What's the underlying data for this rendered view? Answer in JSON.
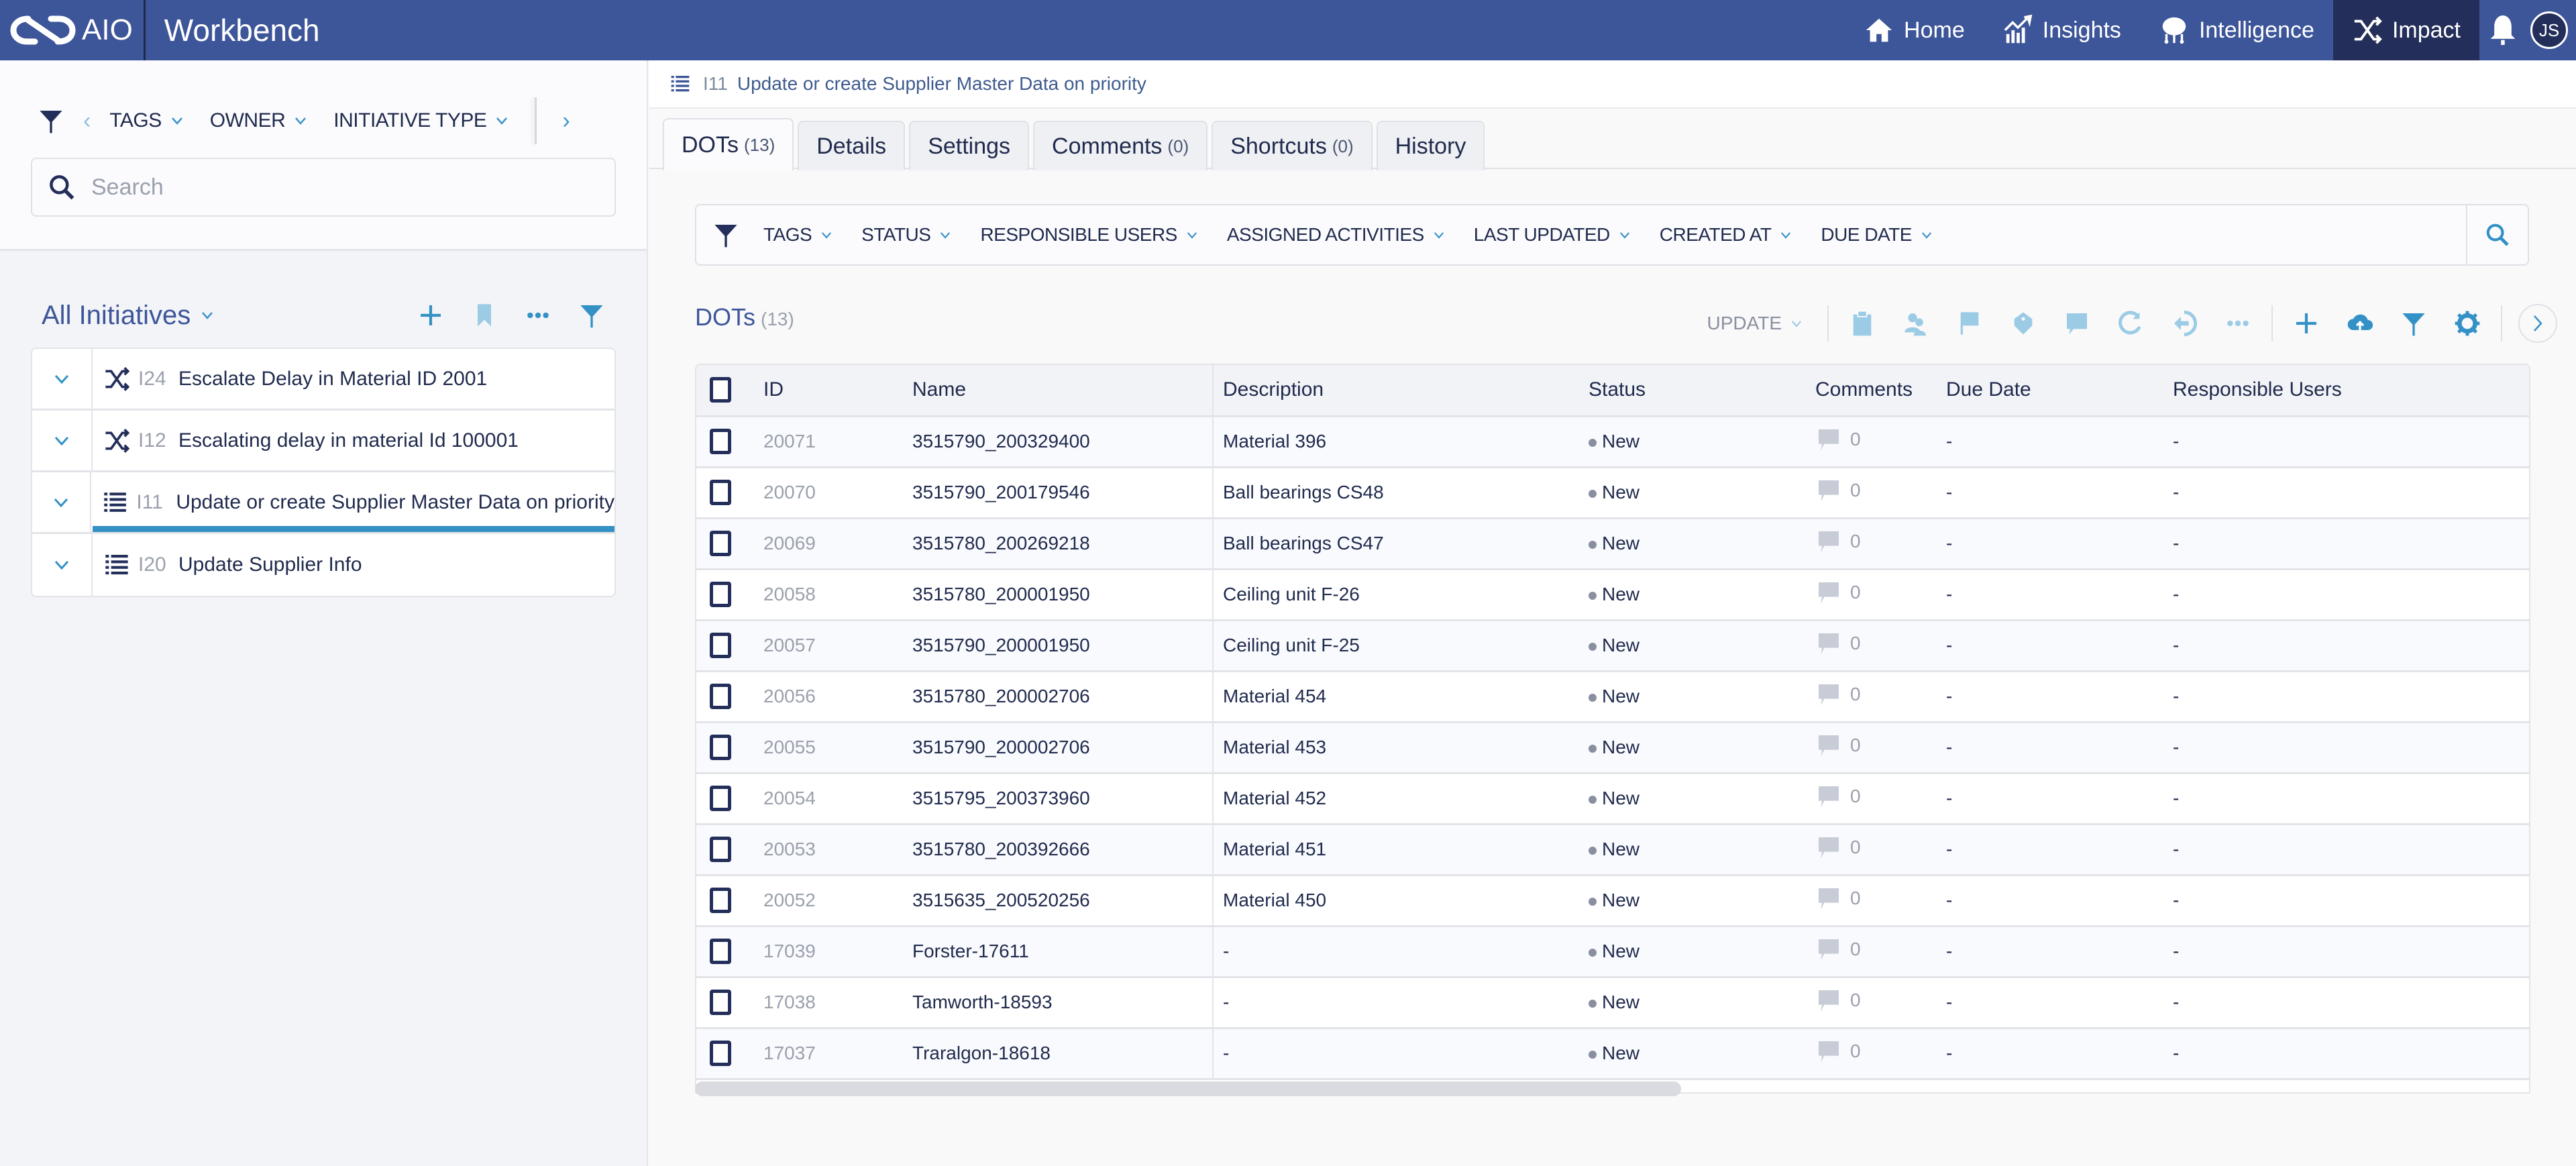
{
  "app": {
    "brand": "AIO",
    "title": "Workbench"
  },
  "nav": {
    "items": [
      {
        "label": "Home",
        "icon": "home-icon"
      },
      {
        "label": "Insights",
        "icon": "chart-icon"
      },
      {
        "label": "Intelligence",
        "icon": "brain-icon"
      },
      {
        "label": "Impact",
        "icon": "shuffle-icon",
        "active": true
      }
    ],
    "avatar_initials": "JS"
  },
  "left_panel": {
    "filters": [
      "TAGS",
      "OWNER",
      "INITIATIVE TYPE"
    ],
    "search_placeholder": "Search",
    "list_title": "All Initiatives",
    "initiatives": [
      {
        "id": "I24",
        "name": "Escalate Delay in Material ID 2001",
        "type": "shuffle"
      },
      {
        "id": "I12",
        "name": "Escalating delay in material Id 100001",
        "type": "shuffle"
      },
      {
        "id": "I11",
        "name": "Update or create Supplier Master Data on priority",
        "type": "checklist",
        "selected": true
      },
      {
        "id": "I20",
        "name": "Update Supplier Info",
        "type": "checklist"
      }
    ]
  },
  "main": {
    "breadcrumb": {
      "id": "I11",
      "name": "Update or create Supplier Master Data on priority"
    },
    "tabs": [
      {
        "label": "DOTs",
        "count": "(13)",
        "active": true
      },
      {
        "label": "Details",
        "count": ""
      },
      {
        "label": "Settings",
        "count": ""
      },
      {
        "label": "Comments",
        "count": "(0)"
      },
      {
        "label": "Shortcuts",
        "count": "(0)"
      },
      {
        "label": "History",
        "count": ""
      }
    ],
    "filters": [
      "TAGS",
      "STATUS",
      "RESPONSIBLE USERS",
      "ASSIGNED ACTIVITIES",
      "LAST UPDATED",
      "CREATED AT",
      "DUE DATE"
    ],
    "section_title": "DOTs",
    "section_count": "(13)",
    "update_label": "UPDATE",
    "table": {
      "columns": [
        "ID",
        "Name",
        "Description",
        "Status",
        "Comments",
        "Due Date",
        "Responsible Users"
      ],
      "rows": [
        {
          "id": "20071",
          "name": "3515790_200329400",
          "description": "Material 396",
          "status": "New",
          "comments": "0",
          "due": "-",
          "responsible": "-",
          "edge": "-"
        },
        {
          "id": "20070",
          "name": "3515790_200179546",
          "description": "Ball bearings CS48",
          "status": "New",
          "comments": "0",
          "due": "-",
          "responsible": "-",
          "edge": "bar"
        },
        {
          "id": "20069",
          "name": "3515780_200269218",
          "description": "Ball bearings CS47",
          "status": "New",
          "comments": "0",
          "due": "-",
          "responsible": "-",
          "edge": "-"
        },
        {
          "id": "20058",
          "name": "3515780_200001950",
          "description": "Ceiling unit F-26",
          "status": "New",
          "comments": "0",
          "due": "-",
          "responsible": "-",
          "edge": "bar"
        },
        {
          "id": "20057",
          "name": "3515790_200001950",
          "description": "Ceiling unit F-25",
          "status": "New",
          "comments": "0",
          "due": "-",
          "responsible": "-",
          "edge": "bar"
        },
        {
          "id": "20056",
          "name": "3515780_200002706",
          "description": "Material 454",
          "status": "New",
          "comments": "0",
          "due": "-",
          "responsible": "-",
          "edge": "bar"
        },
        {
          "id": "20055",
          "name": "3515790_200002706",
          "description": "Material 453",
          "status": "New",
          "comments": "0",
          "due": "-",
          "responsible": "-",
          "edge": "bar"
        },
        {
          "id": "20054",
          "name": "3515795_200373960",
          "description": "Material 452",
          "status": "New",
          "comments": "0",
          "due": "-",
          "responsible": "-",
          "edge": "bar"
        },
        {
          "id": "20053",
          "name": "3515780_200392666",
          "description": "Material 451",
          "status": "New",
          "comments": "0",
          "due": "-",
          "responsible": "-",
          "edge": "bar"
        },
        {
          "id": "20052",
          "name": "3515635_200520256",
          "description": "Material 450",
          "status": "New",
          "comments": "0",
          "due": "-",
          "responsible": "-",
          "edge": "bar"
        },
        {
          "id": "17039",
          "name": "Forster-17611",
          "description": "-",
          "status": "New",
          "comments": "0",
          "due": "-",
          "responsible": "-",
          "edge": "-"
        },
        {
          "id": "17038",
          "name": "Tamworth-18593",
          "description": "-",
          "status": "New",
          "comments": "0",
          "due": "-",
          "responsible": "-",
          "edge": "-"
        },
        {
          "id": "17037",
          "name": "Traralgon-18618",
          "description": "-",
          "status": "New",
          "comments": "0",
          "due": "-",
          "responsible": "-",
          "edge": "-"
        }
      ]
    }
  },
  "colors": {
    "topbar": "#3d5599",
    "active_nav": "#232e5a",
    "accent": "#3391c6",
    "text_dark": "#1f2a4d"
  }
}
